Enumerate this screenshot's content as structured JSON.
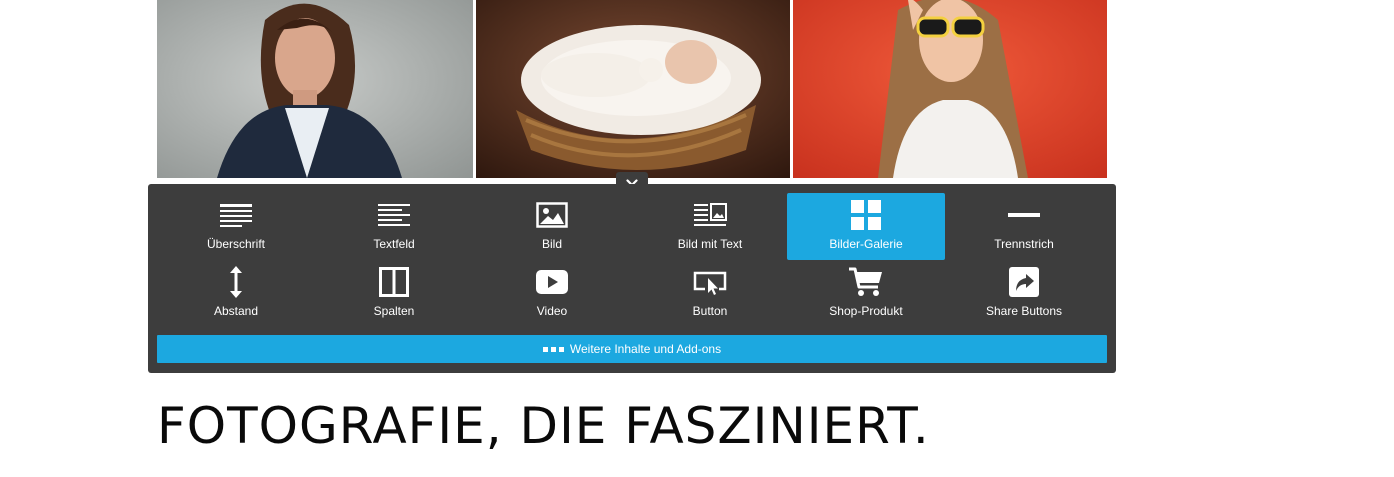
{
  "gallery": {
    "photos": [
      {
        "subject": "portrait-woman-blazer"
      },
      {
        "subject": "newborn-in-basket"
      },
      {
        "subject": "woman-sunglasses-red-background"
      }
    ]
  },
  "panel": {
    "close_icon": "close-icon",
    "items": [
      {
        "label": "Überschrift",
        "icon": "heading-icon"
      },
      {
        "label": "Textfeld",
        "icon": "textfield-icon"
      },
      {
        "label": "Bild",
        "icon": "image-icon"
      },
      {
        "label": "Bild mit Text",
        "icon": "image-text-icon"
      },
      {
        "label": "Bilder-Galerie",
        "icon": "gallery-icon",
        "active": true
      },
      {
        "label": "Trennstrich",
        "icon": "divider-icon"
      },
      {
        "label": "Abstand",
        "icon": "spacing-icon"
      },
      {
        "label": "Spalten",
        "icon": "columns-icon"
      },
      {
        "label": "Video",
        "icon": "video-icon"
      },
      {
        "label": "Button",
        "icon": "button-icon"
      },
      {
        "label": "Shop-Produkt",
        "icon": "cart-icon"
      },
      {
        "label": "Share Buttons",
        "icon": "share-icon"
      }
    ],
    "more_label": "Weitere Inhalte und Add-ons",
    "accent_color": "#1ca8e0",
    "panel_color": "#3d3d3d"
  },
  "page": {
    "heading": "FOTOGRAFIE, DIE FASZINIERT."
  }
}
